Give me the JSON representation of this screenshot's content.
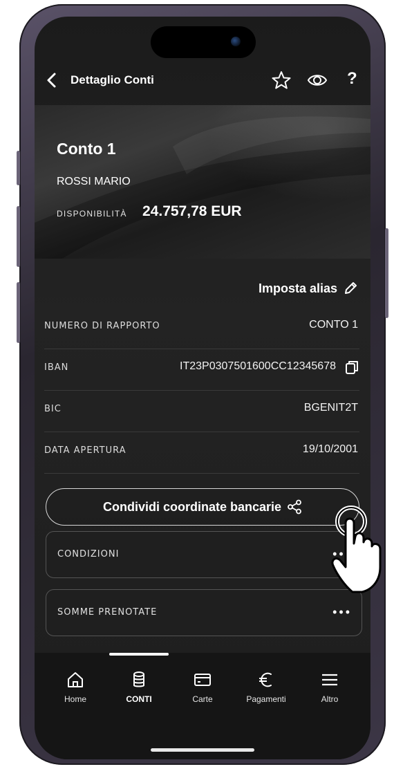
{
  "header": {
    "title": "Dettaglio Conti",
    "icons": [
      "back-icon",
      "star-icon",
      "eye-icon",
      "help-icon"
    ],
    "help_label": "?"
  },
  "card": {
    "title": "Conto 1",
    "holder": "ROSSI MARIO",
    "availability_label": "DISPONIBILITÀ",
    "availability_value": "24.757,78 EUR"
  },
  "alias": {
    "label": "Imposta alias",
    "icon": "pencil-icon"
  },
  "details": [
    {
      "label": "NUMERO DI RAPPORTO",
      "value": "CONTO 1"
    },
    {
      "label": "IBAN",
      "value": "IT23P0307501600CC12345678"
    },
    {
      "label": "BIC",
      "value": "BGENIT2T"
    },
    {
      "label": "DATA APERTURA",
      "value": "19/10/2001"
    }
  ],
  "share_button": {
    "label": "Condividi coordinate bancarie",
    "icon": "share-icon"
  },
  "sections": [
    {
      "label": "CONDIZIONI",
      "more": "•••"
    },
    {
      "label": "SOMME PRENOTATE",
      "more": "•••"
    }
  ],
  "tabbar": {
    "items": [
      {
        "label": "Home",
        "icon": "home-icon",
        "active": false
      },
      {
        "label": "CONTI",
        "icon": "database-icon",
        "active": true
      },
      {
        "label": "Carte",
        "icon": "card-icon",
        "active": false
      },
      {
        "label": "Pagamenti",
        "icon": "euro-icon",
        "active": false
      },
      {
        "label": "Altro",
        "icon": "menu-icon",
        "active": false
      }
    ]
  },
  "colors": {
    "background": "#1e1e1e",
    "text": "#ffffff",
    "border": "#555555"
  }
}
